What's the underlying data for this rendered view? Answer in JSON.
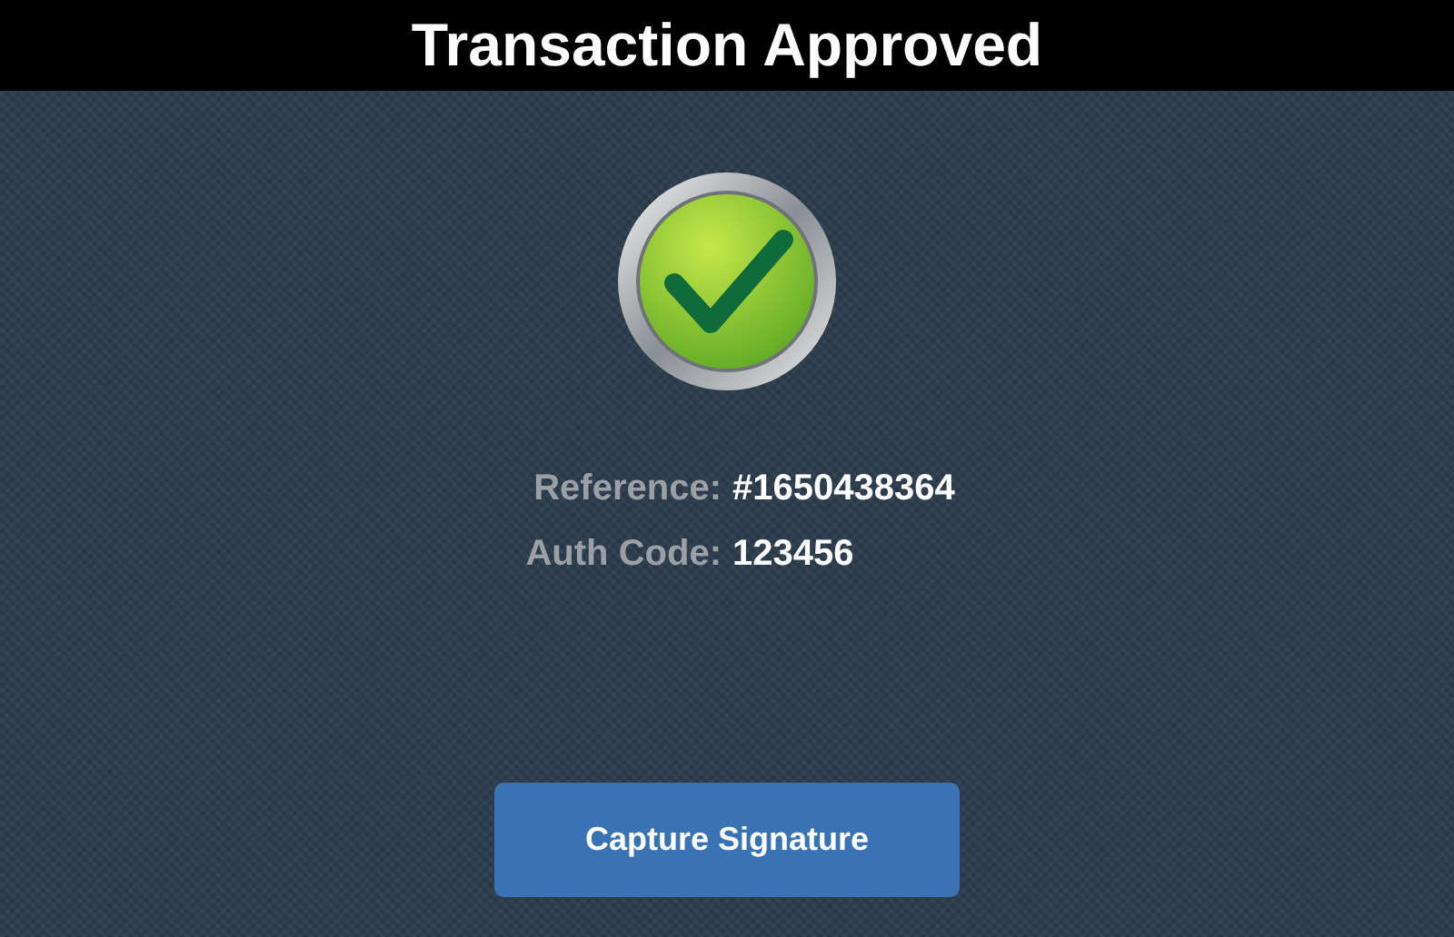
{
  "header": {
    "title": "Transaction Approved"
  },
  "details": [
    {
      "label": "Reference:",
      "value": "#1650438364"
    },
    {
      "label": "Auth Code:",
      "value": "123456"
    }
  ],
  "button": {
    "label": "Capture Signature"
  }
}
